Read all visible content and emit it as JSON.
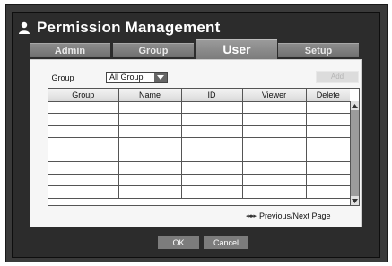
{
  "window": {
    "title": "Permission Management",
    "title_icon": "user-icon"
  },
  "tabs": [
    {
      "label": "Admin",
      "active": false
    },
    {
      "label": "Group",
      "active": false
    },
    {
      "label": "User",
      "active": true
    },
    {
      "label": "Setup",
      "active": false
    }
  ],
  "filter": {
    "group_label": "· Group",
    "group_value": "All Group"
  },
  "toolbar": {
    "add_label": "Add"
  },
  "table": {
    "columns": [
      "Group",
      "Name",
      "ID",
      "Viewer",
      "Delete"
    ],
    "rows": [
      [
        "",
        "",
        "",
        "",
        ""
      ],
      [
        "",
        "",
        "",
        "",
        ""
      ],
      [
        "",
        "",
        "",
        "",
        ""
      ],
      [
        "",
        "",
        "",
        "",
        ""
      ],
      [
        "",
        "",
        "",
        "",
        ""
      ],
      [
        "",
        "",
        "",
        "",
        ""
      ],
      [
        "",
        "",
        "",
        "",
        ""
      ],
      [
        "",
        "",
        "",
        "",
        ""
      ]
    ]
  },
  "pagination": {
    "arrows": "◂◂ ▸▸",
    "label": "Previous/Next Page"
  },
  "footer": {
    "ok_label": "OK",
    "cancel_label": "Cancel"
  },
  "colors": {
    "window_bg": "#2c2c2c",
    "tab_active": "#8a8a8a",
    "panel_bg": "#f6f6f6"
  }
}
